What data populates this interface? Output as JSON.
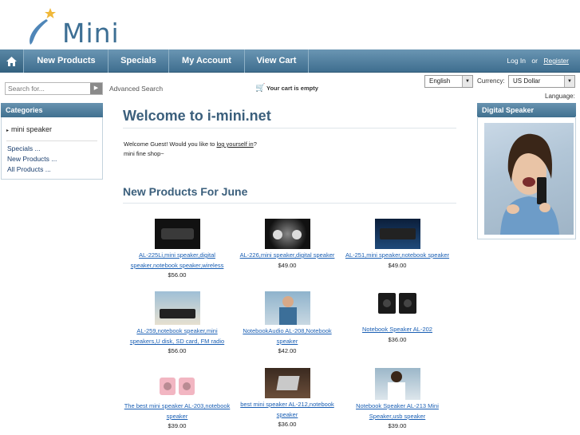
{
  "brand": {
    "logo_text": "Mini"
  },
  "nav": {
    "items": [
      {
        "label": "New Products"
      },
      {
        "label": "Specials"
      },
      {
        "label": "My Account"
      },
      {
        "label": "View Cart"
      }
    ],
    "login": "Log In",
    "or": "or",
    "register": "Register"
  },
  "toolbar": {
    "search_placeholder": "Search for...",
    "advanced_search": "Advanced Search",
    "cart_status": "Your cart is empty",
    "language_value": "English",
    "currency_label": "Currency:",
    "currency_value": "US Dollar",
    "language_label": "Language:"
  },
  "sidebar": {
    "title": "Categories",
    "category": "mini speaker",
    "links": [
      "Specials ...",
      "New Products ...",
      "All Products ..."
    ]
  },
  "right_box": {
    "title": "Digital Speaker"
  },
  "main": {
    "title": "Welcome to i-mini.net",
    "welcome_prefix": "Welcome Guest! Would you like to",
    "login_link": "log yourself in",
    "welcome_suffix": "?",
    "tagline": "mini fine shop~",
    "section_title": "New Products For June"
  },
  "products": [
    {
      "name": "AL-225Li,mini speaker,digital speaker,notebook speaker,wireless",
      "price": "$56.00",
      "color": "#1e1e1e"
    },
    {
      "name": "AL-226,mini speaker,digital speaker",
      "price": "$49.00",
      "color": "#2c2c2c"
    },
    {
      "name": "AL-251,mini speaker,notebook speaker",
      "price": "$49.00",
      "color": "#1b3357"
    },
    {
      "name": "AL-259,notebook speaker,mini speakers,U disk, SD card, FM radio",
      "price": "$56.00",
      "color": "#6f8ea8"
    },
    {
      "name": "NotebookAudio AL-208,Notebook speaker",
      "price": "$42.00",
      "color": "#9bb7c9"
    },
    {
      "name": "Notebook Speaker AL-202",
      "price": "$36.00",
      "color": "#202020"
    },
    {
      "name": "The best mini speaker AL-203,notebook speaker",
      "price": "$39.00",
      "color": "#f0b7c0"
    },
    {
      "name": "best mini speaker AL-212,notebook speaker",
      "price": "$36.00",
      "color": "#3b2a22"
    },
    {
      "name": "Notebook Speaker AL-213 Mini Speaker,usb speaker",
      "price": "$39.00",
      "color": "#b6c9d6"
    }
  ]
}
